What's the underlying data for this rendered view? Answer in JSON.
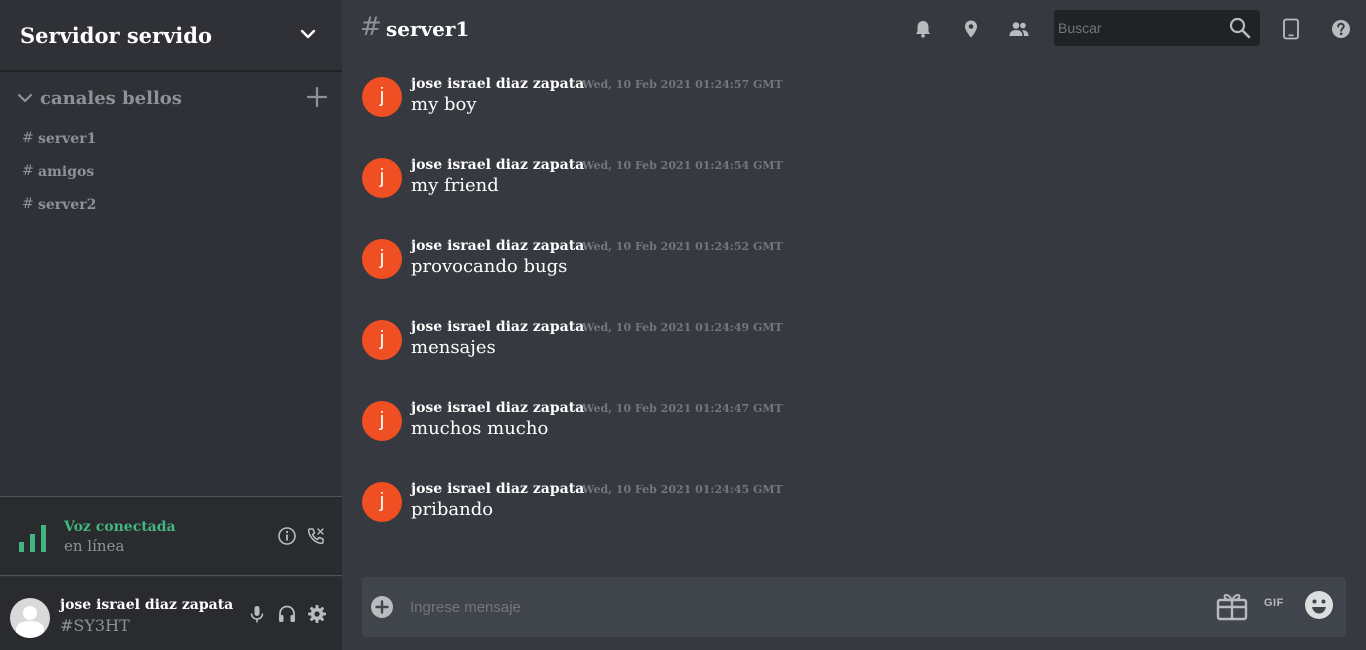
{
  "server": {
    "name": "Servidor servido"
  },
  "category": {
    "label": "canales bellos"
  },
  "channels": [
    {
      "label": "server1"
    },
    {
      "label": "amigos"
    },
    {
      "label": "server2"
    }
  ],
  "channel_hash": "#",
  "voice": {
    "title": "Voz conectada",
    "status": "en línea"
  },
  "user": {
    "name": "jose israel diaz zapata",
    "tag": "#SY3HT"
  },
  "topbar": {
    "channel": "server1",
    "search_placeholder": "Buscar"
  },
  "messages": [
    {
      "avatar_letter": "j",
      "author": "jose israel diaz zapata",
      "time": "Wed, 10 Feb 2021 01:24:57 GMT",
      "text": "my boy"
    },
    {
      "avatar_letter": "j",
      "author": "jose israel diaz zapata",
      "time": "Wed, 10 Feb 2021 01:24:54 GMT",
      "text": "my friend"
    },
    {
      "avatar_letter": "j",
      "author": "jose israel diaz zapata",
      "time": "Wed, 10 Feb 2021 01:24:52 GMT",
      "text": "provocando bugs"
    },
    {
      "avatar_letter": "j",
      "author": "jose israel diaz zapata",
      "time": "Wed, 10 Feb 2021 01:24:49 GMT",
      "text": "mensajes"
    },
    {
      "avatar_letter": "j",
      "author": "jose israel diaz zapata",
      "time": "Wed, 10 Feb 2021 01:24:47 GMT",
      "text": "muchos mucho"
    },
    {
      "avatar_letter": "j",
      "author": "jose israel diaz zapata",
      "time": "Wed, 10 Feb 2021 01:24:45 GMT",
      "text": "pribando"
    }
  ],
  "composer": {
    "placeholder": "Ingrese mensaje",
    "gif_label": "GIF"
  },
  "colors": {
    "sidebar_bg": "#2f3136",
    "main_bg": "#36393f",
    "avatar_orange": "#f04e23",
    "voice_green": "#43b581"
  },
  "icons": {
    "server_menu": "chevron-down-icon",
    "category_toggle": "chevron-down-icon",
    "category_add": "plus-icon",
    "voice_signal": "signal-bars-icon",
    "voice_info": "info-icon",
    "voice_disconnect": "phone-icon",
    "mute": "microphone-icon",
    "deafen": "headphones-icon",
    "settings": "gear-icon",
    "notifications": "bell-icon",
    "pins": "pin-icon",
    "members": "people-icon",
    "search": "search-icon",
    "inbox": "tablet-icon",
    "help": "help-icon",
    "attach": "plus-circle-icon",
    "gift": "gift-icon",
    "emoji": "emoji-icon"
  }
}
